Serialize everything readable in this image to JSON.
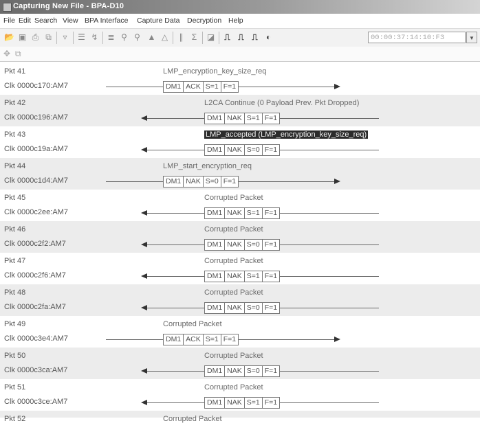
{
  "window": {
    "title": "Capturing New File - BPA-D10"
  },
  "menu": [
    "File",
    "Edit",
    "Search",
    "View",
    "BPA Interface",
    "Capture Data",
    "Decryption",
    "Help"
  ],
  "toolbar": {
    "time_value": "00:00:37:14:10:F3"
  },
  "packets": [
    {
      "pkt": "Pkt 41",
      "clk": "Clk 0000c170:AM7",
      "label": "LMP_encryption_key_size_req",
      "dir": "right",
      "highlight": false,
      "fields": [
        "DM1",
        "ACK",
        "S=1",
        "F=1"
      ]
    },
    {
      "pkt": "Pkt 42",
      "clk": "Clk 0000c196:AM7",
      "label": "L2CA Continue (0 Payload Prev. Pkt Dropped)",
      "dir": "left",
      "highlight": false,
      "fields": [
        "DM1",
        "NAK",
        "S=1",
        "F=1"
      ]
    },
    {
      "pkt": "Pkt 43",
      "clk": "Clk 0000c19a:AM7",
      "label": "LMP_accepted (LMP_encryption_key_size_req)",
      "dir": "left",
      "highlight": true,
      "fields": [
        "DM1",
        "NAK",
        "S=0",
        "F=1"
      ]
    },
    {
      "pkt": "Pkt 44",
      "clk": "Clk 0000c1d4:AM7",
      "label": "LMP_start_encryption_req",
      "dir": "right",
      "highlight": false,
      "fields": [
        "DM1",
        "NAK",
        "S=0",
        "F=1"
      ]
    },
    {
      "pkt": "Pkt 45",
      "clk": "Clk 0000c2ee:AM7",
      "label": "Corrupted Packet",
      "dir": "left",
      "highlight": false,
      "fields": [
        "DM1",
        "NAK",
        "S=1",
        "F=1"
      ]
    },
    {
      "pkt": "Pkt 46",
      "clk": "Clk 0000c2f2:AM7",
      "label": "Corrupted Packet",
      "dir": "left",
      "highlight": false,
      "fields": [
        "DM1",
        "NAK",
        "S=0",
        "F=1"
      ]
    },
    {
      "pkt": "Pkt 47",
      "clk": "Clk 0000c2f6:AM7",
      "label": "Corrupted Packet",
      "dir": "left",
      "highlight": false,
      "fields": [
        "DM1",
        "NAK",
        "S=1",
        "F=1"
      ]
    },
    {
      "pkt": "Pkt 48",
      "clk": "Clk 0000c2fa:AM7",
      "label": "Corrupted Packet",
      "dir": "left",
      "highlight": false,
      "fields": [
        "DM1",
        "NAK",
        "S=0",
        "F=1"
      ]
    },
    {
      "pkt": "Pkt 49",
      "clk": "Clk 0000c3e4:AM7",
      "label": "Corrupted Packet",
      "dir": "right",
      "highlight": false,
      "fields": [
        "DM1",
        "ACK",
        "S=1",
        "F=1"
      ]
    },
    {
      "pkt": "Pkt 50",
      "clk": "Clk 0000c3ca:AM7",
      "label": "Corrupted Packet",
      "dir": "left",
      "highlight": false,
      "fields": [
        "DM1",
        "NAK",
        "S=0",
        "F=1"
      ]
    },
    {
      "pkt": "Pkt 51",
      "clk": "Clk 0000c3ce:AM7",
      "label": "Corrupted Packet",
      "dir": "left",
      "highlight": false,
      "fields": [
        "DM1",
        "NAK",
        "S=1",
        "F=1"
      ]
    },
    {
      "pkt": "Pkt 52",
      "label": "Corrupted Packet",
      "dir": "right",
      "highlight": false
    }
  ]
}
